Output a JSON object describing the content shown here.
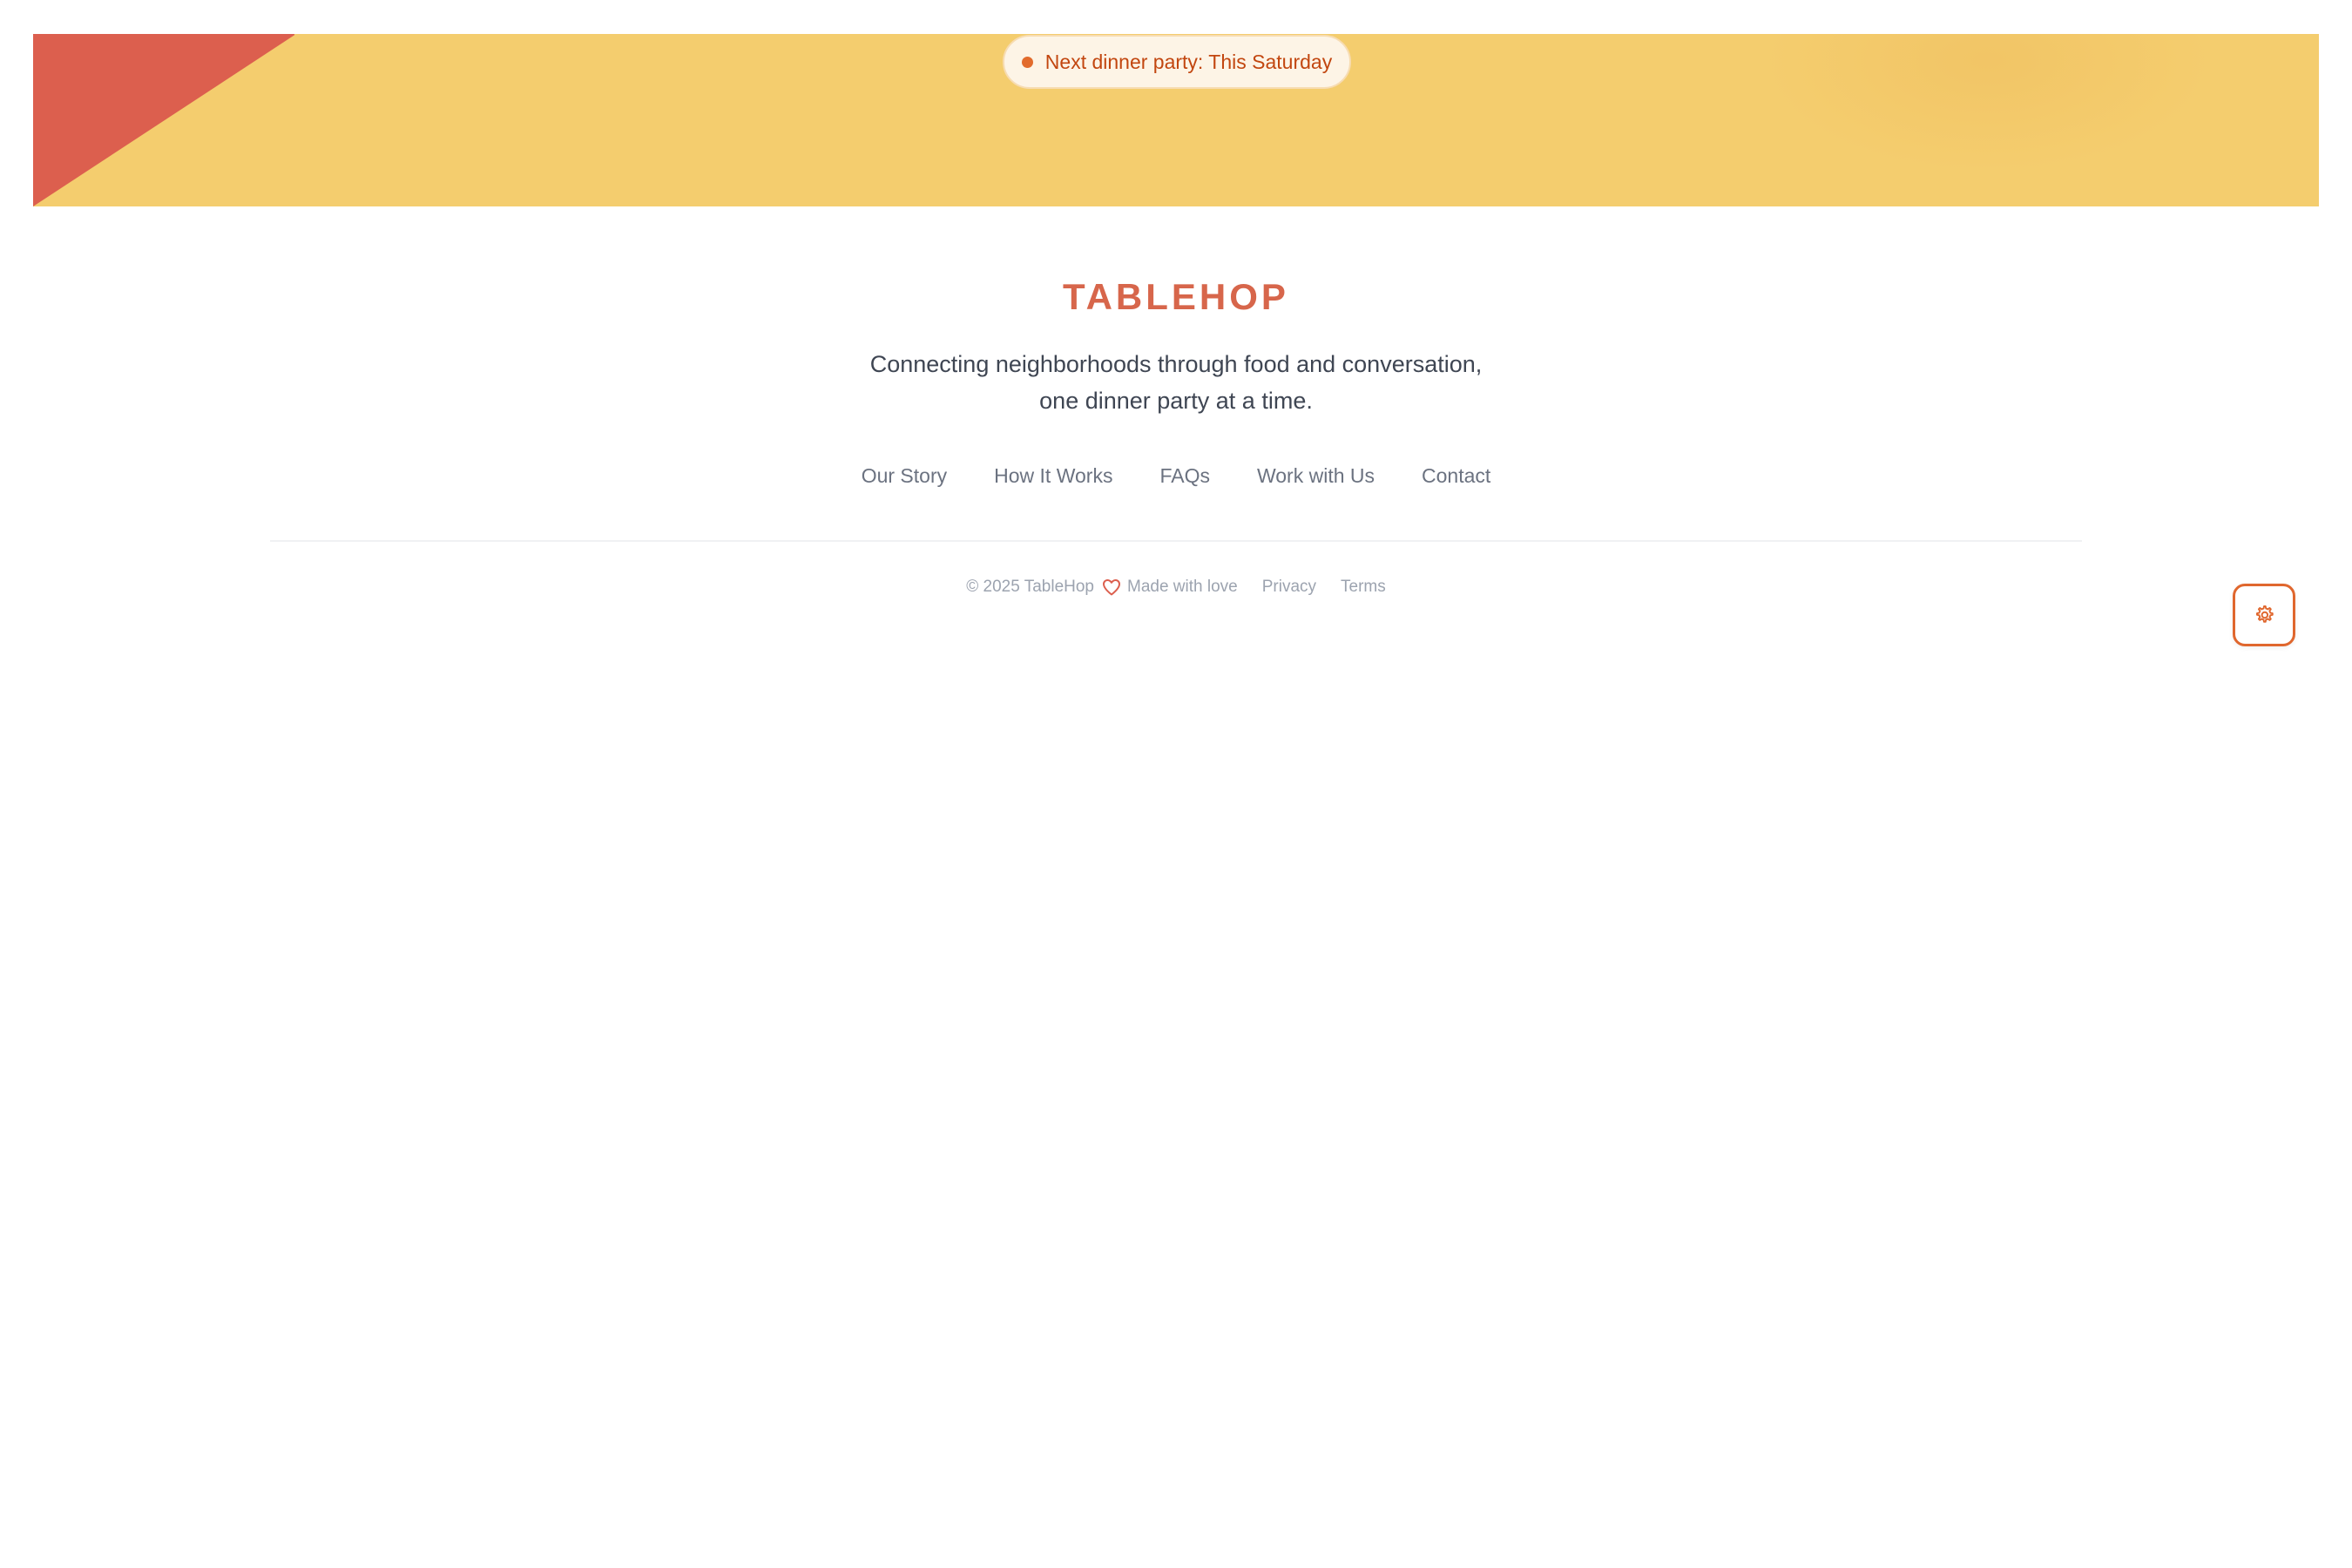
{
  "announcement": {
    "text": "Next dinner party: This Saturday"
  },
  "footer": {
    "brand": "TABLEHOP",
    "tagline": "Connecting neighborhoods through food and conversation, one dinner party at a time.",
    "nav": [
      {
        "label": "Our Story"
      },
      {
        "label": "How It Works"
      },
      {
        "label": "FAQs"
      },
      {
        "label": "Work with Us"
      },
      {
        "label": "Contact"
      }
    ],
    "legal": {
      "copyright": "© 2025 TableHop",
      "made_with": "Made with love",
      "privacy": "Privacy",
      "terms": "Terms"
    }
  },
  "icons": {
    "announcement_dot": "status-dot-icon",
    "love": "heart-icon",
    "settings": "gear-icon"
  },
  "colors": {
    "banner_yellow": "#f4cd6e",
    "banner_red": "#dc5f4e",
    "brand_coral": "#d7664b",
    "accent_orange": "#e0672e",
    "pill_text": "#c2460f"
  }
}
